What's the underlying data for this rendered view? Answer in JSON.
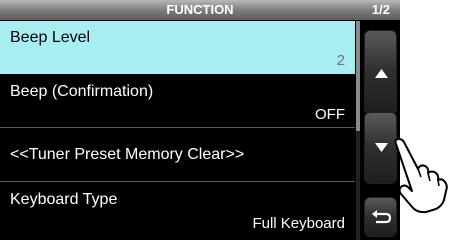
{
  "header": {
    "title": "FUNCTION",
    "page": "1/2"
  },
  "items": [
    {
      "name": "Beep Level",
      "value": "2",
      "selected": true
    },
    {
      "name": "Beep (Confirmation)",
      "value": "OFF",
      "selected": false
    },
    {
      "name": "<<Tuner Preset Memory Clear>>",
      "value": "",
      "selected": false
    },
    {
      "name": "Keyboard Type",
      "value": "Full Keyboard",
      "selected": false
    }
  ],
  "buttons": {
    "up": "up-arrow-icon",
    "down": "down-arrow-icon",
    "back": "return-arrow-icon"
  },
  "colors": {
    "selected_bg": "#a6eef2",
    "header": "#7a7a7a",
    "background": "#000000"
  }
}
